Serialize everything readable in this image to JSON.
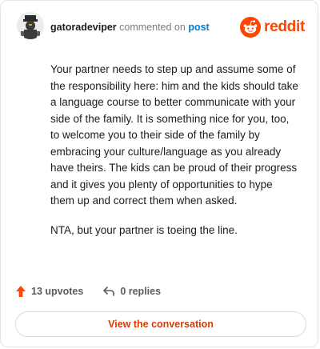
{
  "header": {
    "username": "gatoradeviper",
    "action": "commented on",
    "post_link": "post",
    "brand": "reddit",
    "brand_color": "#ff4500"
  },
  "comment": {
    "paragraphs": [
      "Your partner needs to step up and assume some of the responsibility here: him and the kids should take a language course to better communicate with your side of the family. It is something nice for you, too, to welcome you to their side of the family by embracing your culture/language as you already have theirs. The kids can be proud of their progress and it gives you plenty of opportunities to hype them up and correct them when asked.",
      "NTA, but your partner is toeing the line."
    ]
  },
  "stats": {
    "upvotes": "13 upvotes",
    "replies": "0 replies",
    "upvote_icon": "upvote-arrow-icon",
    "reply_icon": "reply-arrow-icon"
  },
  "cta": {
    "label": "View the conversation",
    "color": "#d93a00"
  }
}
